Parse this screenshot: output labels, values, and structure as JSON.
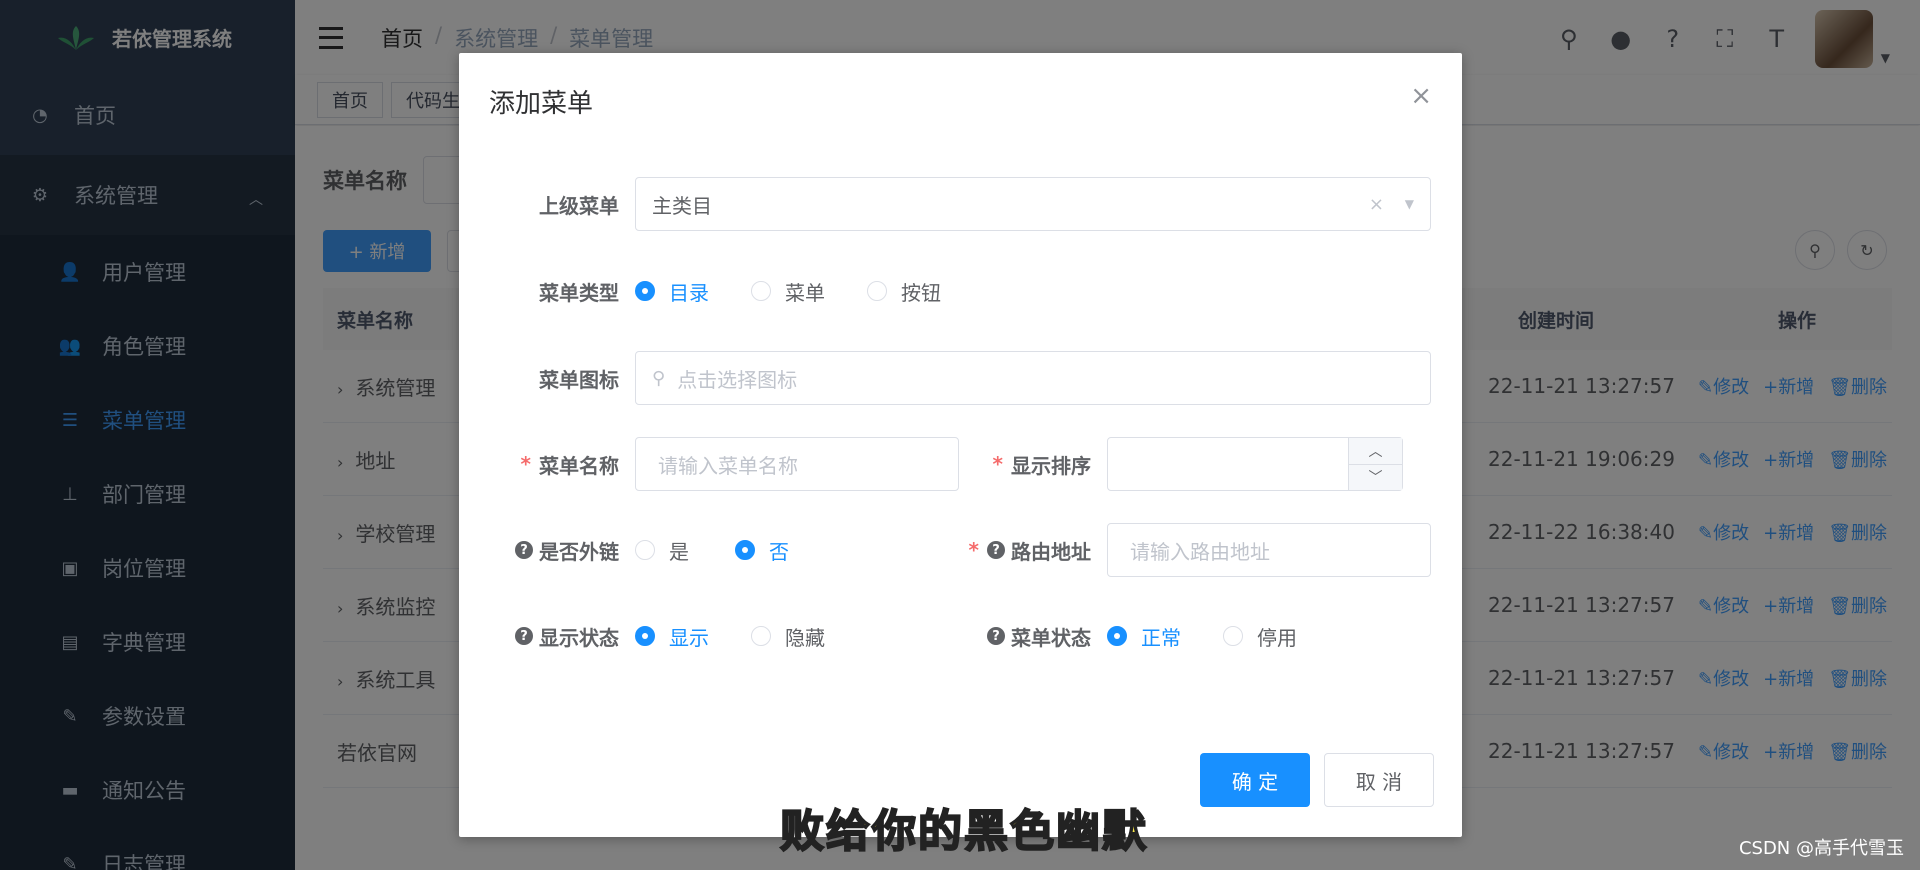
{
  "app": {
    "title": "若依管理系统"
  },
  "sidebar": {
    "items": [
      {
        "label": "首页",
        "icon": "dashboard-icon"
      },
      {
        "label": "系统管理",
        "icon": "gear-icon"
      }
    ],
    "sub_items": [
      {
        "label": "用户管理",
        "icon": "user-icon"
      },
      {
        "label": "角色管理",
        "icon": "peoples-icon"
      },
      {
        "label": "菜单管理",
        "icon": "tree-table-icon",
        "active": true
      },
      {
        "label": "部门管理",
        "icon": "tree-icon"
      },
      {
        "label": "岗位管理",
        "icon": "post-icon"
      },
      {
        "label": "字典管理",
        "icon": "dict-icon"
      },
      {
        "label": "参数设置",
        "icon": "edit-icon"
      },
      {
        "label": "通知公告",
        "icon": "message-icon"
      },
      {
        "label": "日志管理",
        "icon": "log-icon"
      }
    ]
  },
  "header": {
    "breadcrumb": [
      "首页",
      "系统管理",
      "菜单管理"
    ],
    "breadcrumb_sep": "/"
  },
  "tags": [
    "首页",
    "代码生成"
  ],
  "main": {
    "search_label": "菜单名称",
    "add_button": "+ 新增",
    "table": {
      "headers": {
        "name": "菜单名称",
        "time": "创建时间",
        "ops": "操作"
      },
      "rows": [
        {
          "name": "系统管理",
          "time": "22-11-21 13:27:57",
          "expandable": true
        },
        {
          "name": "地址",
          "time": "22-11-21 19:06:29",
          "expandable": true
        },
        {
          "name": "学校管理",
          "time": "22-11-22 16:38:40",
          "expandable": true
        },
        {
          "name": "系统监控",
          "time": "22-11-21 13:27:57",
          "expandable": true
        },
        {
          "name": "系统工具",
          "time": "22-11-21 13:27:57",
          "expandable": true
        },
        {
          "name": "若依官网",
          "time": "22-11-21 13:27:57",
          "expandable": false
        }
      ],
      "ops": {
        "edit": "修改",
        "add": "新增",
        "delete": "删除"
      }
    }
  },
  "dialog": {
    "title": "添加菜单",
    "close": "×",
    "parent_label": "上级菜单",
    "parent_value": "主类目",
    "type_label": "菜单类型",
    "type_options": [
      "目录",
      "菜单",
      "按钮"
    ],
    "type_selected": 0,
    "icon_label": "菜单图标",
    "icon_placeholder": "点击选择图标",
    "name_label": "菜单名称",
    "name_placeholder": "请输入菜单名称",
    "order_label": "显示排序",
    "order_value": "",
    "external_label": "是否外链",
    "external_options": [
      "是",
      "否"
    ],
    "external_selected": 1,
    "route_label": "路由地址",
    "route_placeholder": "请输入路由地址",
    "visible_label": "显示状态",
    "visible_options": [
      "显示",
      "隐藏"
    ],
    "visible_selected": 0,
    "status_label": "菜单状态",
    "status_options": [
      "正常",
      "停用"
    ],
    "status_selected": 0,
    "confirm": "确 定",
    "cancel": "取 消"
  },
  "overlay_caption": "败给你的黑色幽默",
  "watermark": "CSDN @高手代雪玉",
  "colors": {
    "primary": "#1890ff",
    "sidebar": "#304156",
    "danger": "#f56c6c"
  }
}
